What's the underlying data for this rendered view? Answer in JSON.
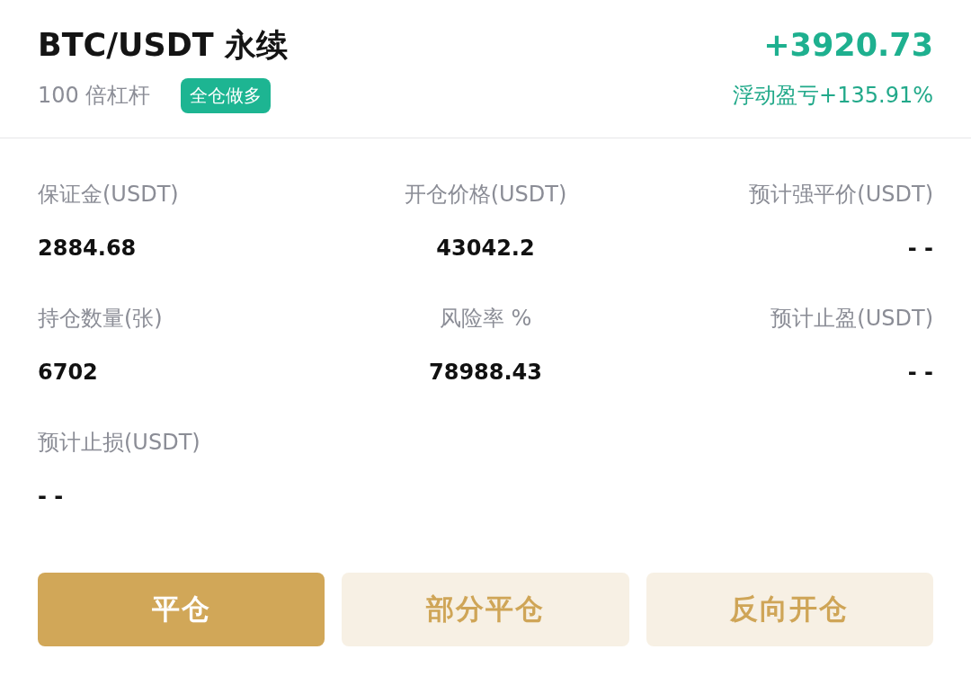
{
  "header": {
    "title": "BTC/USDT 永续",
    "leverage": "100 倍杠杆",
    "badge": "全仓做多",
    "pnl_amount": "+3920.73",
    "pnl_ratio": "浮动盈亏+135.91%"
  },
  "metrics": [
    {
      "label": "保证金(USDT)",
      "value": "2884.68"
    },
    {
      "label": "开仓价格(USDT)",
      "value": "43042.2"
    },
    {
      "label": "预计强平价(USDT)",
      "value": "- -"
    },
    {
      "label": "持仓数量(张)",
      "value": "6702"
    },
    {
      "label": "风险率 %",
      "value": "78988.43"
    },
    {
      "label": "预计止盈(USDT)",
      "value": "- -"
    },
    {
      "label": "预计止损(USDT)",
      "value": "- -"
    }
  ],
  "actions": [
    {
      "label": "平仓",
      "kind": "primary"
    },
    {
      "label": "部分平仓",
      "kind": "secondary"
    },
    {
      "label": "反向开仓",
      "kind": "secondary"
    }
  ]
}
